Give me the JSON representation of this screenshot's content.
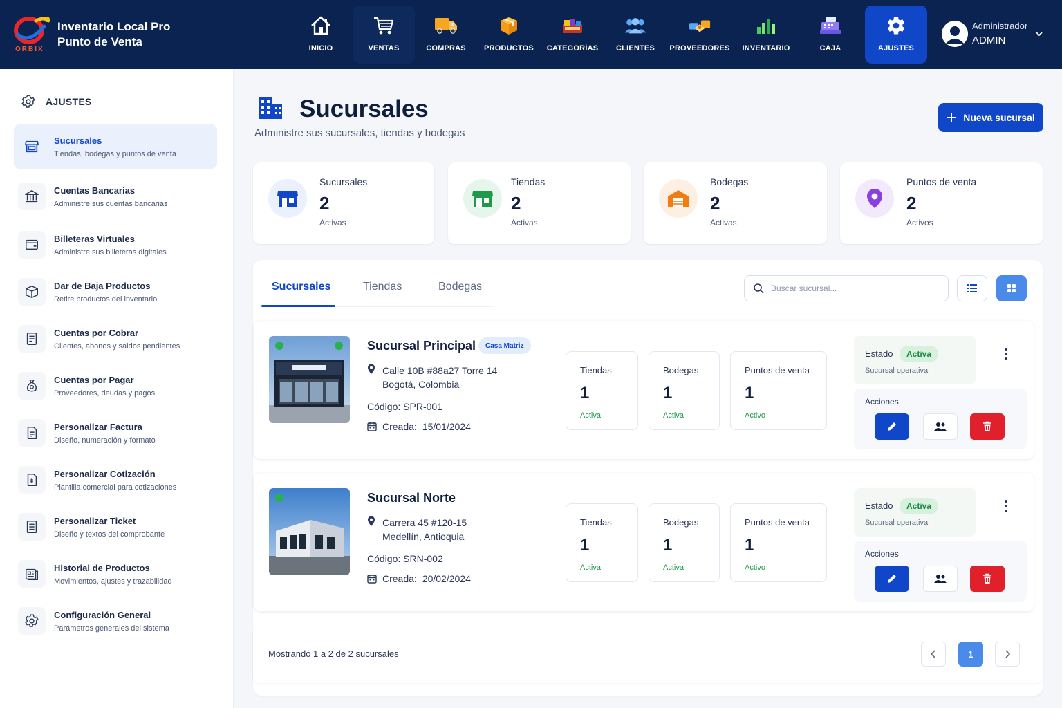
{
  "app": {
    "title": "Inventario Local Pro",
    "subtitle": "Punto de Venta",
    "logo_text": "ORBIX"
  },
  "nav": [
    {
      "label": "INICIO",
      "icon": "home-icon"
    },
    {
      "label": "VENTAS",
      "icon": "cart-icon"
    },
    {
      "label": "COMPRAS",
      "icon": "truck-icon"
    },
    {
      "label": "PRODUCTOS",
      "icon": "box-icon"
    },
    {
      "label": "CATEGORÍAS",
      "icon": "categories-icon"
    },
    {
      "label": "CLIENTES",
      "icon": "clients-icon"
    },
    {
      "label": "PROVEEDORES",
      "icon": "suppliers-icon"
    },
    {
      "label": "INVENTARIO",
      "icon": "bar-chart-icon"
    },
    {
      "label": "CAJA",
      "icon": "cash-register-icon"
    },
    {
      "label": "AJUSTES",
      "icon": "gear-icon"
    }
  ],
  "user": {
    "role": "Administrador",
    "name": "ADMIN"
  },
  "sidebar": {
    "heading": "AJUSTES",
    "items": [
      {
        "title": "Sucursales",
        "subtitle": "Tiendas, bodegas y puntos de venta",
        "icon": "store-icon"
      },
      {
        "title": "Cuentas Bancarias",
        "subtitle": "Administre sus cuentas bancarias",
        "icon": "bank-icon"
      },
      {
        "title": "Billeteras Virtuales",
        "subtitle": "Administre sus billeteras digitales",
        "icon": "wallet-icon"
      },
      {
        "title": "Dar de Baja Productos",
        "subtitle": "Retire productos del inventario",
        "icon": "box-remove-icon"
      },
      {
        "title": "Cuentas por Cobrar",
        "subtitle": "Clientes, abonos y saldos pendientes",
        "icon": "receivable-icon"
      },
      {
        "title": "Cuentas por Pagar",
        "subtitle": "Proveedores, deudas y pagos",
        "icon": "money-bag-icon"
      },
      {
        "title": "Personalizar Factura",
        "subtitle": "Diseño, numeración y formato",
        "icon": "invoice-icon"
      },
      {
        "title": "Personalizar Cotización",
        "subtitle": "Plantilla comercial para cotizaciones",
        "icon": "quote-icon"
      },
      {
        "title": "Personalizar Ticket",
        "subtitle": "Diseño y textos del comprobante",
        "icon": "ticket-icon"
      },
      {
        "title": "Historial de Productos",
        "subtitle": "Movimientos, ajustes y trazabilidad",
        "icon": "history-icon"
      },
      {
        "title": "Configuración General",
        "subtitle": "Parámetros generales del sistema",
        "icon": "settings-icon"
      }
    ]
  },
  "page": {
    "title": "Sucursales",
    "subtitle": "Administre sus sucursales, tiendas y bodegas",
    "new_button": "Nueva sucursal"
  },
  "stats": [
    {
      "label": "Sucursales",
      "value": "2",
      "foot": "Activas",
      "color": "#1046c8",
      "bg": "#eaf1fd"
    },
    {
      "label": "Tiendas",
      "value": "2",
      "foot": "Activas",
      "color": "#1f9a4b",
      "bg": "#e7f6ec"
    },
    {
      "label": "Bodegas",
      "value": "2",
      "foot": "Activas",
      "color": "#f07c12",
      "bg": "#fdf0e3"
    },
    {
      "label": "Puntos de venta",
      "value": "2",
      "foot": "Activos",
      "color": "#8a3fe0",
      "bg": "#f2eafc"
    }
  ],
  "tabs": [
    "Sucursales",
    "Tiendas",
    "Bodegas"
  ],
  "search": {
    "placeholder": "Buscar sucursal..."
  },
  "branches": [
    {
      "name": "Sucursal Principal",
      "badge": "Casa Matriz",
      "address1": "Calle 10B #88a27 Torre 14",
      "address2": "Bogotá, Colombia",
      "code_label": "Código:",
      "code": "SPR-001",
      "created_label": "Creada:",
      "created": "15/01/2024",
      "metrics": [
        {
          "label": "Tiendas",
          "value": "1",
          "status": "Activa"
        },
        {
          "label": "Bodegas",
          "value": "1",
          "status": "Activa"
        },
        {
          "label": "Puntos de venta",
          "value": "1",
          "status": "Activo"
        }
      ],
      "status_label": "Estado",
      "status": "Activa",
      "status_sub": "Sucursal operativa",
      "actions_label": "Acciones"
    },
    {
      "name": "Sucursal Norte",
      "badge": "",
      "address1": "Carrera 45 #120-15",
      "address2": "Medellín, Antioquia",
      "code_label": "Código:",
      "code": "SRN-002",
      "created_label": "Creada:",
      "created": "20/02/2024",
      "metrics": [
        {
          "label": "Tiendas",
          "value": "1",
          "status": "Activa"
        },
        {
          "label": "Bodegas",
          "value": "1",
          "status": "Activa"
        },
        {
          "label": "Puntos de venta",
          "value": "1",
          "status": "Activo"
        }
      ],
      "status_label": "Estado",
      "status": "Activa",
      "status_sub": "Sucursal operativa",
      "actions_label": "Acciones"
    }
  ],
  "pagination": {
    "summary": "Mostrando 1 a 2 de 2 sucursales",
    "current": "1"
  },
  "colors": {
    "navy": "#0b2350",
    "primary": "#1046c8",
    "success": "#1f9a4b",
    "danger": "#e0202b"
  }
}
